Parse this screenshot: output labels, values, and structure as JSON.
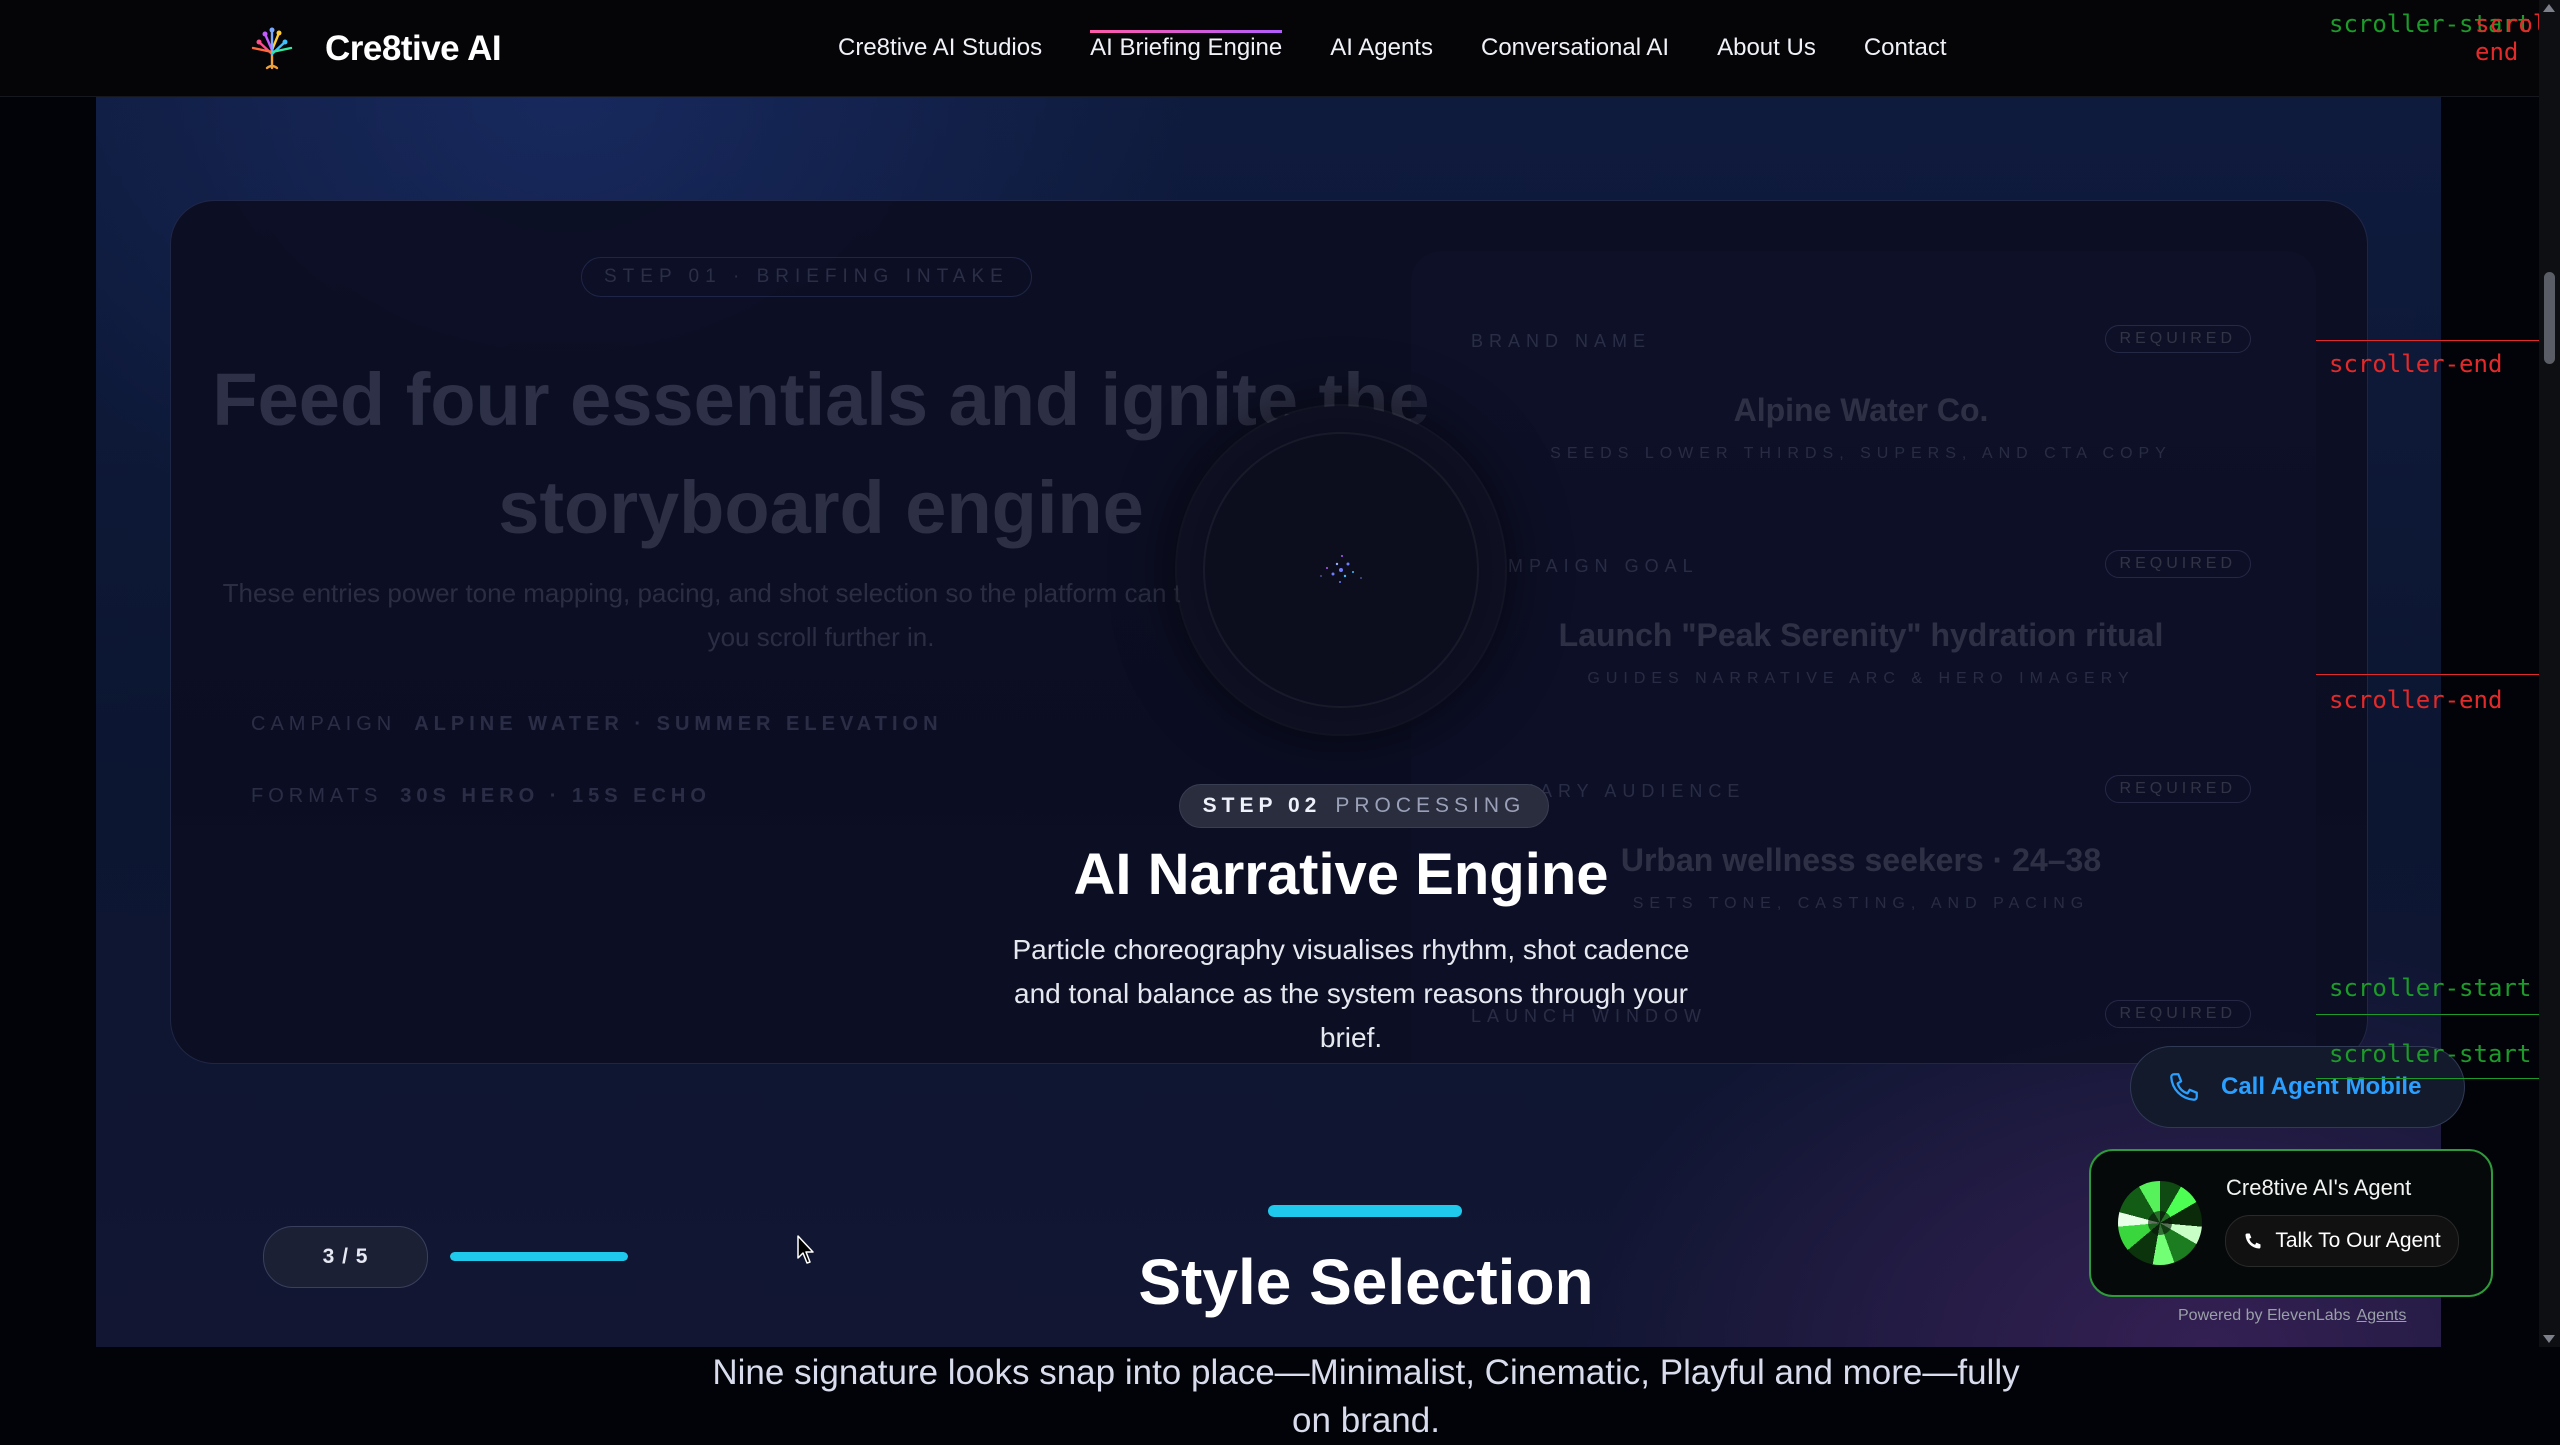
{
  "nav": {
    "brand": "Cre8tive AI",
    "links": [
      "Cre8tive AI Studios",
      "AI Briefing Engine",
      "AI Agents",
      "Conversational AI",
      "About Us",
      "Contact"
    ],
    "active_index": 1
  },
  "intake": {
    "step_pill": "STEP 01 · BRIEFING INTAKE",
    "heading": "Feed four essentials and ignite the storyboard engine",
    "subtext": "These entries power tone mapping, pacing, and shot selection so the platform can transform the brief as you scroll further in.",
    "campaign_label": "CAMPAIGN",
    "campaign_value": "ALPINE WATER · SUMMER ELEVATION",
    "formats_label": "FORMATS",
    "formats_value": "30S HERO · 15S ECHO",
    "fields": [
      {
        "label": "BRAND NAME",
        "badge": "REQUIRED",
        "value": "Alpine Water Co.",
        "hint": "SEEDS LOWER THIRDS, SUPERS, AND CTA COPY"
      },
      {
        "label": "CAMPAIGN GOAL",
        "badge": "REQUIRED",
        "value": "Launch \"Peak Serenity\" hydration ritual",
        "hint": "GUIDES NARRATIVE ARC & HERO IMAGERY"
      },
      {
        "label": "PRIMARY AUDIENCE",
        "badge": "REQUIRED",
        "value": "Urban wellness seekers · 24–38",
        "hint": "SETS TONE, CASTING, AND PACING"
      },
      {
        "label": "LAUNCH WINDOW",
        "badge": "REQUIRED",
        "value": "",
        "hint": ""
      }
    ]
  },
  "processing": {
    "step_num": "STEP 02",
    "step_word": "PROCESSING",
    "title": "AI Narrative Engine",
    "description": "Particle choreography visualises rhythm, shot cadence and tonal balance as the system reasons through your brief."
  },
  "progress": {
    "counter": "3 / 5",
    "fraction": 1.0
  },
  "section": {
    "title": "Style Selection",
    "description": "Nine signature looks snap into place—Minimalist, Cinematic, Playful and more—fully on brand."
  },
  "markers": {
    "start": "scroller-start",
    "end": "scroller-end",
    "colors": {
      "start": "#1c9b2a",
      "end": "#e32a2a"
    }
  },
  "agent": {
    "call_button": "Call Agent Mobile",
    "widget_title": "Cre8tive AI's Agent",
    "talk_button": "Talk To Our Agent",
    "powered_prefix": "Powered by ElevenLabs",
    "powered_link": "Agents"
  },
  "colors": {
    "accent": "#1ec9ec",
    "nav_underline": "#ff5aa8",
    "agent_border": "#2e9b3a",
    "call_text": "#2a9fff"
  },
  "icons": {
    "phone": "phone-icon",
    "logo": "tree-logo-icon"
  }
}
